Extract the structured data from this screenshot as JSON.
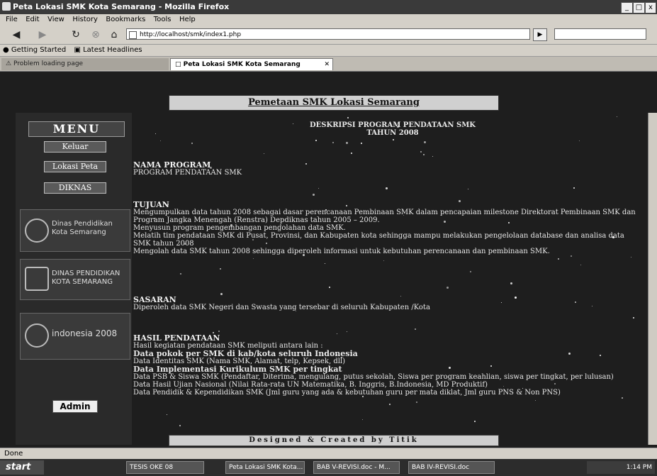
{
  "window": {
    "title": "Peta Lokasi SMK Kota Semarang - Mozilla Firefox"
  },
  "menubar": [
    "File",
    "Edit",
    "View",
    "History",
    "Bookmarks",
    "Tools",
    "Help"
  ],
  "navbar": {
    "url": "http://localhost/smk/index1.php",
    "go_label": "▶"
  },
  "bookmarks": [
    "Getting Started",
    "Latest Headlines"
  ],
  "tabs": [
    {
      "label": "Problem loading page"
    },
    {
      "label": "Peta Lokasi SMK Kota Semarang"
    }
  ],
  "page": {
    "banner": "Pemetaan SMK Lokasi Semarang",
    "menu_title": "MENU",
    "menu_items": [
      "Keluar",
      "Lokasi Peta",
      "DIKNAS"
    ],
    "logos": [
      {
        "text": "Dinas Pendidikan Kota Semarang"
      },
      {
        "text": "DINAS PENDIDIKAN KOTA SEMARANG"
      },
      {
        "text": "indonesia 2008"
      }
    ],
    "admin_label": "Admin",
    "heading_line1": "DESKRIPSI  PROGRAM  PENDATAAN SMK",
    "heading_line2": "TAHUN 2008",
    "nama_program_title": "NAMA PROGRAM",
    "nama_program_text": "PROGRAM PENDATAAN SMK",
    "tujuan_title": "TUJUAN",
    "tujuan_items": [
      "Mengumpulkan data tahun 2008 sebagai dasar perencanaan Pembinaan SMK dalam pencapaian milestone Direktorat Pembinaan SMK dan Program Jangka Menengah (Renstra) Depdiknas tahun 2005 – 2009.",
      "Menyusun program pengembangan pengolahan data SMK.",
      "Melatih tim pendataan SMK di Pusat, Provinsi, dan Kabupaten kota sehingga mampu melakukan pengelolaan database dan analisa data SMK tahun 2008",
      "Mengolah data SMK tahun 2008 sehingga diperoleh informasi untuk kebutuhan perencanaan dan pembinaan SMK."
    ],
    "sasaran_title": "SASARAN",
    "sasaran_text": "Diperoleh data SMK Negeri dan Swasta yang tersebar di seluruh Kabupaten /Kota",
    "hasil_title": "HASIL PENDATAAN",
    "hasil_intro": "Hasil kegiatan pendataan SMK meliputi antara lain :",
    "hasil_items": [
      "Data pokok per SMK di kab/kota seluruh Indonesia",
      "Data Identitas SMK (Nama SMK, Alamat, telp, Kepsek, dll)",
      "Data Implementasi Kurikulum SMK per tingkat",
      "Data PSB & Siswa SMK (Pendaftar, Diterima, mengulang, putus sekolah, Siswa per program keahlian, siswa per tingkat, per lulusan)",
      "Data Hasil Ujian Nasional (Nilai Rata-rata UN Matematika, B. Inggris, B.Indonesia, MD Produktif)",
      "Data Pendidik & Kependidikan SMK (Jml guru yang ada & kebutuhan guru per mata diklat, Jml guru PNS & Non PNS)"
    ],
    "footer": "Designed & Created by Titik"
  },
  "status": {
    "text": "Done"
  },
  "taskbar": {
    "start_label": "start",
    "tasks": [
      "TESIS OKE 08",
      "Peta Lokasi SMK Kota...",
      "BAB V-REVISI.doc - M...",
      "BAB IV-REVISI.doc"
    ],
    "clock": "1:14 PM"
  }
}
